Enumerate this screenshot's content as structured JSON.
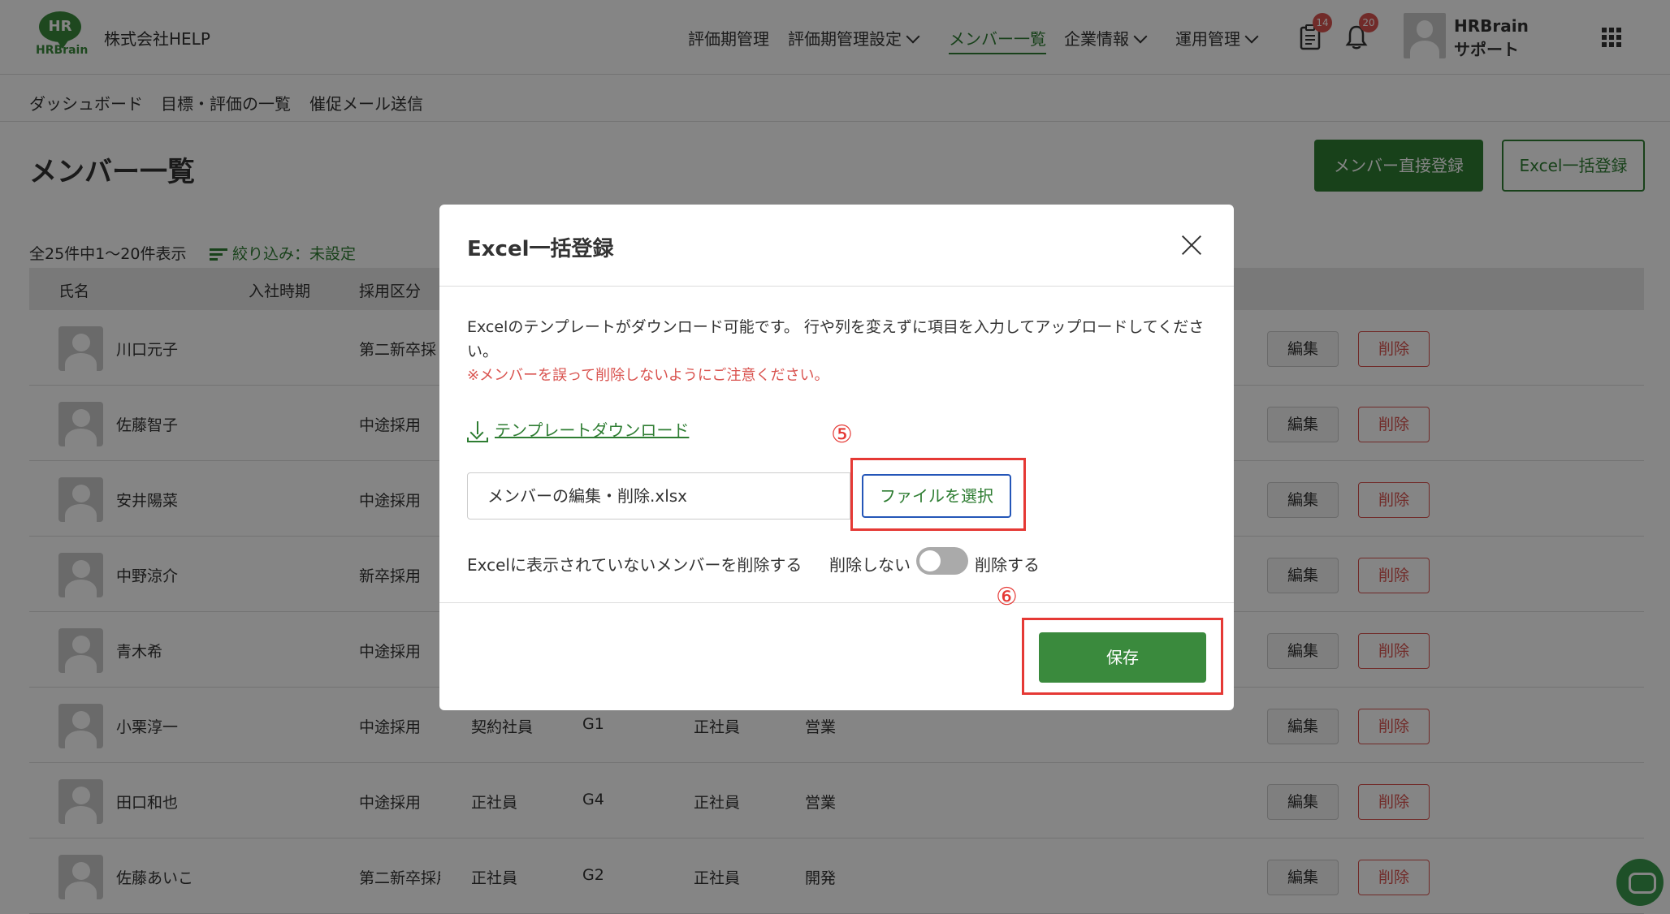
{
  "header": {
    "logo_text": "HR",
    "logo_brand": "HRBrain",
    "company": "株式会社HELP",
    "nav": [
      {
        "label": "評価期管理"
      },
      {
        "label": "評価期管理設定"
      },
      {
        "label": "メンバー一覧"
      },
      {
        "label": "企業情報"
      },
      {
        "label": "運用管理"
      }
    ],
    "doc_badge": "14",
    "bell_badge": "20",
    "user_name": "HRBrain サポート"
  },
  "subnav": [
    "ダッシュボード",
    "目標・評価の一覧",
    "催促メール送信"
  ],
  "page": {
    "title": "メンバー一覧",
    "direct_register": "メンバー直接登録",
    "excel_register": "Excel一括登録",
    "count": "全25件中1〜20件表示",
    "filter": "絞り込み：未設定"
  },
  "table": {
    "headers": [
      "氏名",
      "入社時期",
      "採用区分"
    ],
    "edit_label": "編集",
    "delete_label": "削除",
    "rows": [
      {
        "name": "川口元子",
        "hire": "第二新卒採",
        "type": "",
        "grade": "",
        "emp": "",
        "dept": ""
      },
      {
        "name": "佐藤智子",
        "hire": "中途採用",
        "type": "",
        "grade": "",
        "emp": "",
        "dept": ""
      },
      {
        "name": "安井陽菜",
        "hire": "中途採用",
        "type": "",
        "grade": "",
        "emp": "",
        "dept": ""
      },
      {
        "name": "中野涼介",
        "hire": "新卒採用",
        "type": "",
        "grade": "",
        "emp": "",
        "dept": ""
      },
      {
        "name": "青木希",
        "hire": "中途採用",
        "type": "",
        "grade": "",
        "emp": "",
        "dept": ""
      },
      {
        "name": "小栗淳一",
        "hire": "中途採用",
        "type": "契約社員",
        "grade": "G1",
        "emp": "正社員",
        "dept": "営業"
      },
      {
        "name": "田口和也",
        "hire": "中途採用",
        "type": "正社員",
        "grade": "G4",
        "emp": "正社員",
        "dept": "営業"
      },
      {
        "name": "佐藤あいこ",
        "hire": "第二新卒採用",
        "type": "正社員",
        "grade": "G2",
        "emp": "正社員",
        "dept": "開発"
      }
    ]
  },
  "modal": {
    "title": "Excel一括登録",
    "description": "Excelのテンプレートがダウンロード可能です。 行や列を変えずに項目を入力してアップロードしてください。",
    "warning": "※メンバーを誤って削除しないようにご注意ください。",
    "template_link": "テンプレートダウンロード",
    "file_name": "メンバーの編集・削除.xlsx",
    "file_button": "ファイルを選択",
    "delete_option_label": "Excelに表示されていないメンバーを削除する",
    "toggle_off_label": "削除しない",
    "toggle_on_label": "削除する",
    "toggle_on": false,
    "save_label": "保存",
    "step5": "⑤",
    "step6": "⑥"
  },
  "colors": {
    "primary": "#2e7d32",
    "danger": "#d9534f",
    "highlight": "#e53935"
  }
}
